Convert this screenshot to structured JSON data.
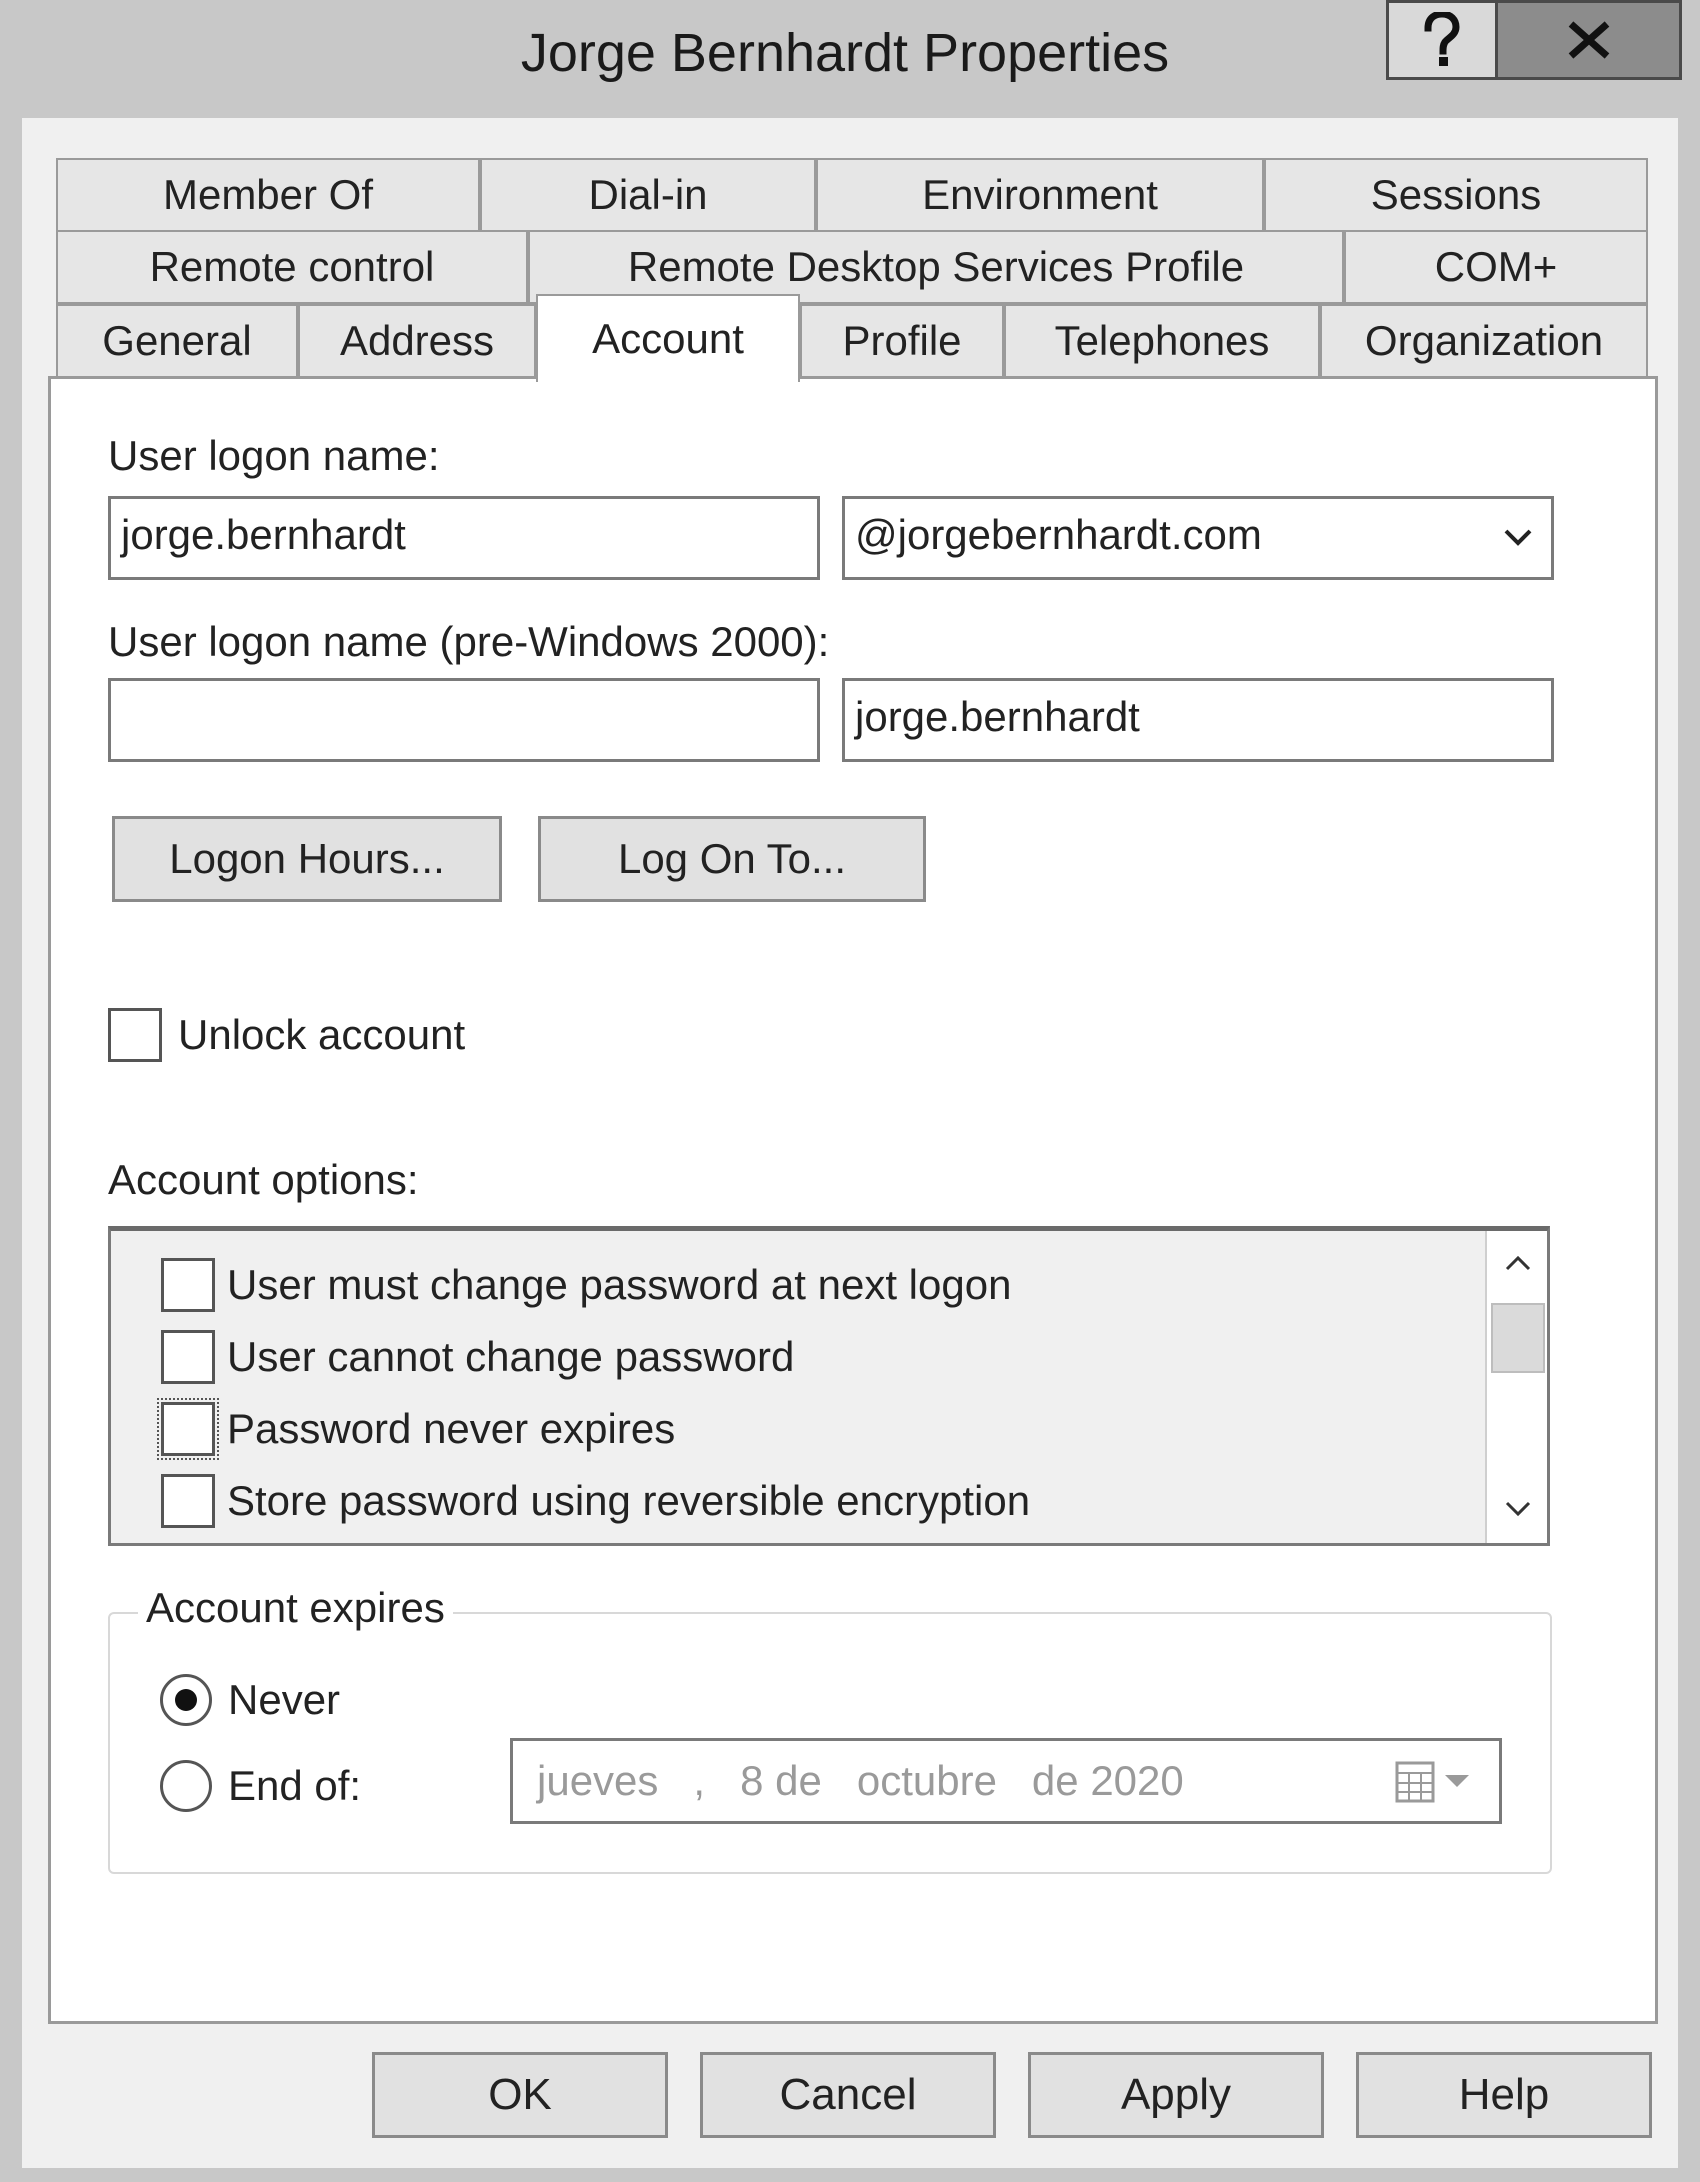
{
  "window": {
    "title": "Jorge Bernhardt Properties",
    "help_button": "?",
    "close_button": "X"
  },
  "tabs": {
    "row1": [
      "Member Of",
      "Dial-in",
      "Environment",
      "Sessions"
    ],
    "row2": [
      "Remote control",
      "Remote Desktop Services Profile",
      "COM+"
    ],
    "row3": [
      "General",
      "Address",
      "Account",
      "Profile",
      "Telephones",
      "Organization"
    ],
    "active": "Account"
  },
  "account": {
    "logon_name_label": "User logon name:",
    "logon_name_value": "jorge.bernhardt",
    "domain_value": "@jorgebernhardt.com",
    "pre2000_label": "User logon name (pre-Windows 2000):",
    "pre2000_domain_value": "",
    "pre2000_user_value": "jorge.bernhardt",
    "logon_hours_button": "Logon Hours...",
    "log_on_to_button": "Log On To...",
    "unlock_account_label": "Unlock account",
    "options_label": "Account options:",
    "options": [
      {
        "label": "User must change password at next logon",
        "checked": false
      },
      {
        "label": "User cannot change password",
        "checked": false
      },
      {
        "label": "Password never expires",
        "checked": false
      },
      {
        "label": "Store password using reversible encryption",
        "checked": false
      }
    ],
    "expires_group_label": "Account expires",
    "never_label": "Never",
    "end_of_label": "End of:",
    "end_of_date": "jueves   ,   8 de   octubre   de 2020",
    "selected_expiry": "Never"
  },
  "footer": {
    "ok": "OK",
    "cancel": "Cancel",
    "apply": "Apply",
    "help": "Help"
  }
}
